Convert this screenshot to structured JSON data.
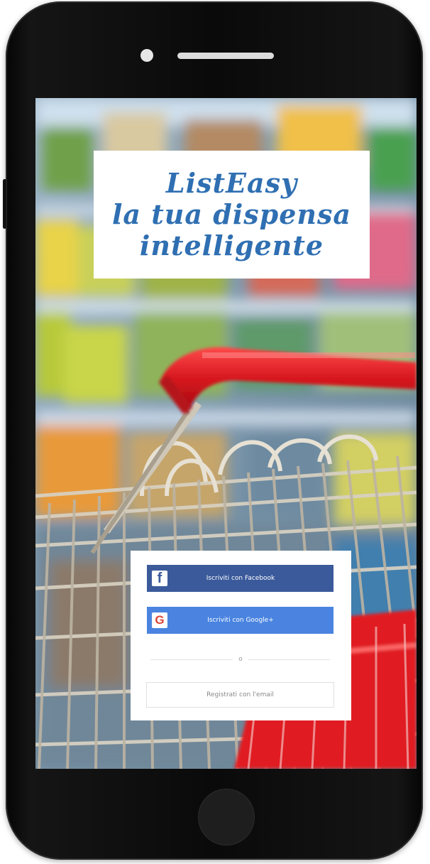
{
  "app": {
    "title_lines": [
      "ListEasy",
      "la tua dispensa",
      "intelligente"
    ]
  },
  "auth": {
    "facebook": {
      "icon": "f",
      "label": "Iscriviti con Facebook"
    },
    "google": {
      "icon": "G",
      "label": "Iscriviti con Google+"
    },
    "divider_text": "o",
    "email_label": "Registrati con l'email"
  },
  "colors": {
    "title": "#2f6fb2",
    "facebook": "#3b5a9b",
    "google": "#4a84e0",
    "cart_red": "#e01b24"
  }
}
